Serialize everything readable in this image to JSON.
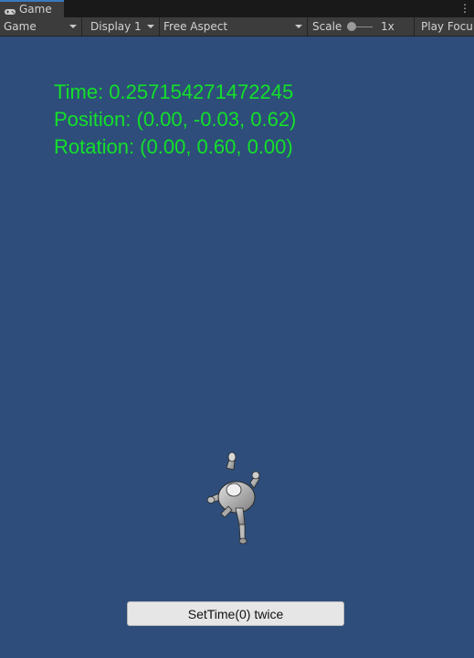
{
  "tab": {
    "label": "Game",
    "icon": "gamepad-icon"
  },
  "toolbar": {
    "view_mode": "Game",
    "display": "Display 1",
    "aspect": "Free Aspect",
    "scale_label": "Scale",
    "scale_value": "1x",
    "play_focus": "Play Focu"
  },
  "hud": {
    "time": "Time: 0.257154271472245",
    "position": "Position: (0.00, -0.03, 0.62)",
    "rotation": "Rotation: (0.00, 0.60, 0.00)"
  },
  "button": {
    "label": "SetTime(0) twice"
  },
  "colors": {
    "background": "#2e4d7a",
    "hud_text": "#14e02a",
    "tab_accent": "#3a79bb"
  }
}
